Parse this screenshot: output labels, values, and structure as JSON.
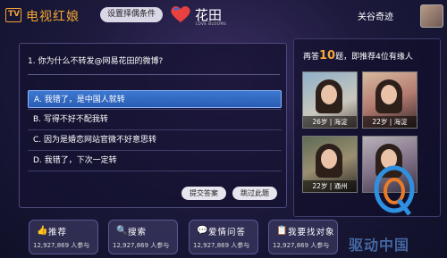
{
  "header": {
    "logo_text": "TV",
    "app_title": "电视红娘",
    "settings_button": "设置择偶条件",
    "brand_name": "花田",
    "brand_sub": "LOVE BLOOMS",
    "user_name": "关谷奇迹"
  },
  "question": {
    "text": "1. 你为什么不转发@网易花田的微博?",
    "options": [
      {
        "label": "A. 我错了，是中国人就转",
        "selected": true
      },
      {
        "label": "B. 写得不好不配我转",
        "selected": false
      },
      {
        "label": "C. 因为是婚恋网站官微不好意思转",
        "selected": false
      },
      {
        "label": "D. 我错了，下次一定转",
        "selected": false
      }
    ],
    "submit_button": "提交答案",
    "skip_button": "跳过此题"
  },
  "recommend": {
    "prefix": "再答",
    "count": "10",
    "suffix": "题，即推荐4位有缘人",
    "cards": [
      {
        "label": "26岁 | 海淀"
      },
      {
        "label": "22岁 | 海淀"
      },
      {
        "label": "22岁 | 通州"
      },
      {
        "label": ""
      }
    ]
  },
  "tiles": [
    {
      "icon": "thumbs-up-icon",
      "glyph": "👍",
      "label": "推荐",
      "count": "12,927,869 人参与"
    },
    {
      "icon": "search-icon",
      "glyph": "🔍",
      "label": "搜索",
      "count": "12,927,869 人参与"
    },
    {
      "icon": "chat-icon",
      "glyph": "💬",
      "label": "爱情问答",
      "count": "12,927,869 人参与"
    },
    {
      "icon": "user-card-icon",
      "glyph": "📋",
      "label": "我要找对象",
      "count": "12,927,869 人参与"
    }
  ],
  "watermark": {
    "text": "驱动中国"
  },
  "colors": {
    "accent": "#f3a53a",
    "selected": "#3d78d0"
  }
}
